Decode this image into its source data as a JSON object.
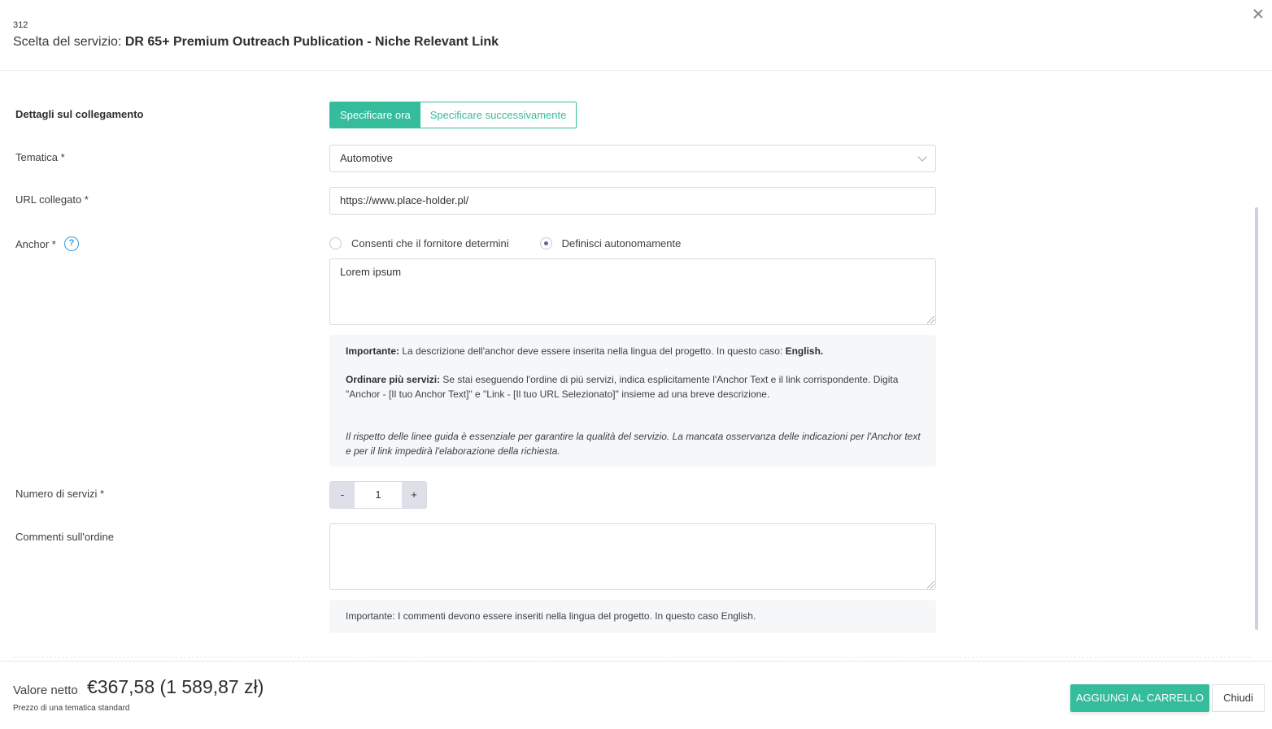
{
  "header": {
    "id": "312",
    "title_prefix": "Scelta del servizio: ",
    "service_name": "DR 65+ Premium Outreach Publication - Niche Relevant Link"
  },
  "form": {
    "link_details": {
      "label": "Dettagli sul collegamento",
      "options": [
        "Specificare ora",
        "Specificare successivamente"
      ],
      "selected": "Specificare ora"
    },
    "topic": {
      "label": "Tematica *",
      "value": "Automotive"
    },
    "linked_url": {
      "label": "URL collegato *",
      "value": "https://www.place-holder.pl/"
    },
    "anchor": {
      "label": "Anchor *",
      "help_icon": "question-circle-icon",
      "radio_options": [
        "Consenti che il fornitore determini",
        "Definisci autonomamente"
      ],
      "selected": "Definisci autonomamente",
      "value": "Lorem ipsum"
    },
    "anchor_info": {
      "p1_bold": "Importante:",
      "p1_text": " La descrizione dell'anchor deve essere inserita nella lingua del progetto. In questo caso: ",
      "p1_lang": "English.",
      "p2_bold": "Ordinare più servizi:",
      "p2_text": " Se stai eseguendo l'ordine di più servizi, indica esplicitamente l'Anchor Text e il link corrispondente. Digita \"Anchor - [Il tuo Anchor Text]\" e \"Link - [Il tuo URL Selezionato]\" insieme ad una breve descrizione.",
      "p3_italic": "Il rispetto delle linee guida è essenziale per garantire la qualità del servizio. La mancata osservanza delle indicazioni per l'Anchor text e per il link impedirà l'elaborazione della richiesta."
    },
    "quantity": {
      "label": "Numero di servizi *",
      "minus": "-",
      "value": "1",
      "plus": "+"
    },
    "comments": {
      "label": "Commenti sull'ordine",
      "value": "",
      "info": "Importante: I commenti devono essere inseriti nella lingua del progetto. In questo caso English."
    }
  },
  "footer": {
    "net_label": "Valore netto",
    "net_value": "€367,58 (1 589,87 zł)",
    "note": "Prezzo di una tematica standard",
    "add_to_cart": "AGGIUNGI AL CARRELLO",
    "close": "Chiudi"
  },
  "colors": {
    "accent": "#35bc9b",
    "help": "#3a97d9"
  }
}
